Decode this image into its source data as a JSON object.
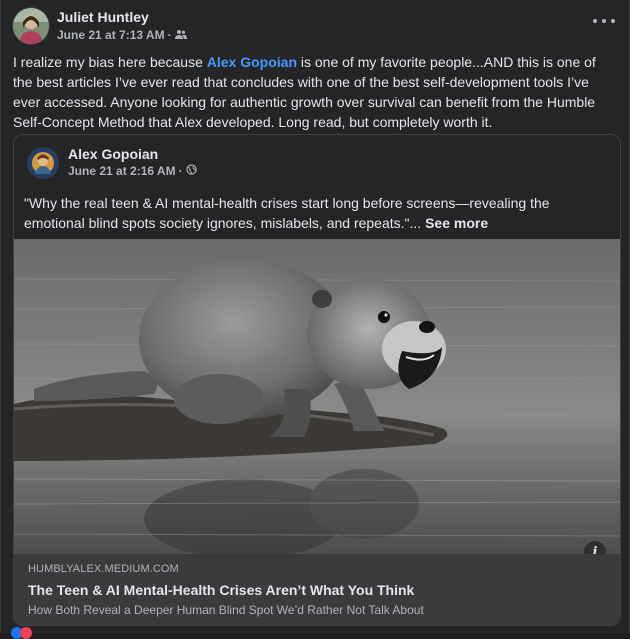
{
  "post": {
    "author": "Juliet Huntley",
    "timestamp": "June 21 at 7:13 AM",
    "audience_icon": "friends-icon",
    "body_before": "I realize my bias here because ",
    "mention": "Alex Gopoian",
    "body_after": " is one of my favorite people...AND this is one of the best articles I’ve ever read that concludes with one of the best self-development tools I’ve ever accessed. Anyone looking for authentic growth over survival can benefit from the Humble Self-Concept Method that Alex developed. Long read, but completely worth it."
  },
  "shared": {
    "author": "Alex Gopoian",
    "timestamp": "June 21 at 2:16 AM",
    "audience_icon": "globe-icon",
    "text": "\"Why the real teen & AI mental-health crises start long before screens—revealing the emotional blind spots society ignores, mislabels, and repeats.\"...",
    "see_more": "See more"
  },
  "link": {
    "domain": "HUMBLYALEX.MEDIUM.COM",
    "title": "The Teen & AI Mental-Health Crises Aren’t What You Think",
    "subtitle": "How Both Reveal a Deeper Human Blind Spot We’d Rather Not Talk About",
    "info_label": "i"
  },
  "colors": {
    "background": "#242526",
    "mention": "#4599ff",
    "link_panel": "#3a3b3c"
  }
}
